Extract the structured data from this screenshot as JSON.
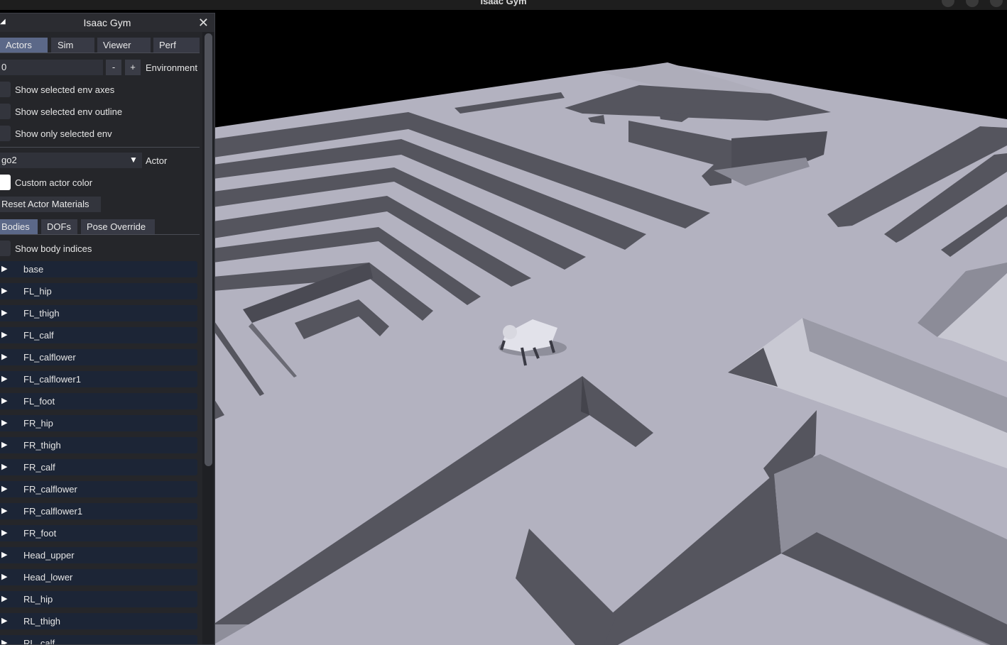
{
  "window": {
    "title": "Isaac Gym"
  },
  "panel": {
    "title": "Isaac Gym",
    "tabs": [
      {
        "label": "Actors",
        "active": true
      },
      {
        "label": "Sim",
        "active": false
      },
      {
        "label": "Viewer",
        "active": false
      },
      {
        "label": "Perf",
        "active": false
      }
    ],
    "env_index": "0",
    "env_minus": "-",
    "env_plus": "+",
    "env_label": "Environment",
    "checkboxes": [
      {
        "label": "Show selected env axes",
        "checked": false
      },
      {
        "label": "Show selected env outline",
        "checked": false
      },
      {
        "label": "Show only selected env",
        "checked": false
      }
    ],
    "actor_select": "go2",
    "actor_label": "Actor",
    "custom_color_label": "Custom actor color",
    "reset_materials_label": "Reset Actor Materials",
    "subtabs": [
      {
        "label": "Bodies",
        "active": true
      },
      {
        "label": "DOFs",
        "active": false
      },
      {
        "label": "Pose Override",
        "active": false
      }
    ],
    "show_body_indices_label": "Show body indices",
    "bodies": [
      "base",
      "FL_hip",
      "FL_thigh",
      "FL_calf",
      "FL_calflower",
      "FL_calflower1",
      "FL_foot",
      "FR_hip",
      "FR_thigh",
      "FR_calf",
      "FR_calflower",
      "FR_calflower1",
      "FR_foot",
      "Head_upper",
      "Head_lower",
      "RL_hip",
      "RL_thigh",
      "RL_calf"
    ]
  },
  "colors": {
    "panel_bg": "#25262a",
    "tab_active": "#5b6888",
    "tab_inactive": "#383a45",
    "list_row": "#1c2536",
    "terrain_top": "#b3b2c0",
    "terrain_wall": "#55555e",
    "sky": "#000000"
  }
}
